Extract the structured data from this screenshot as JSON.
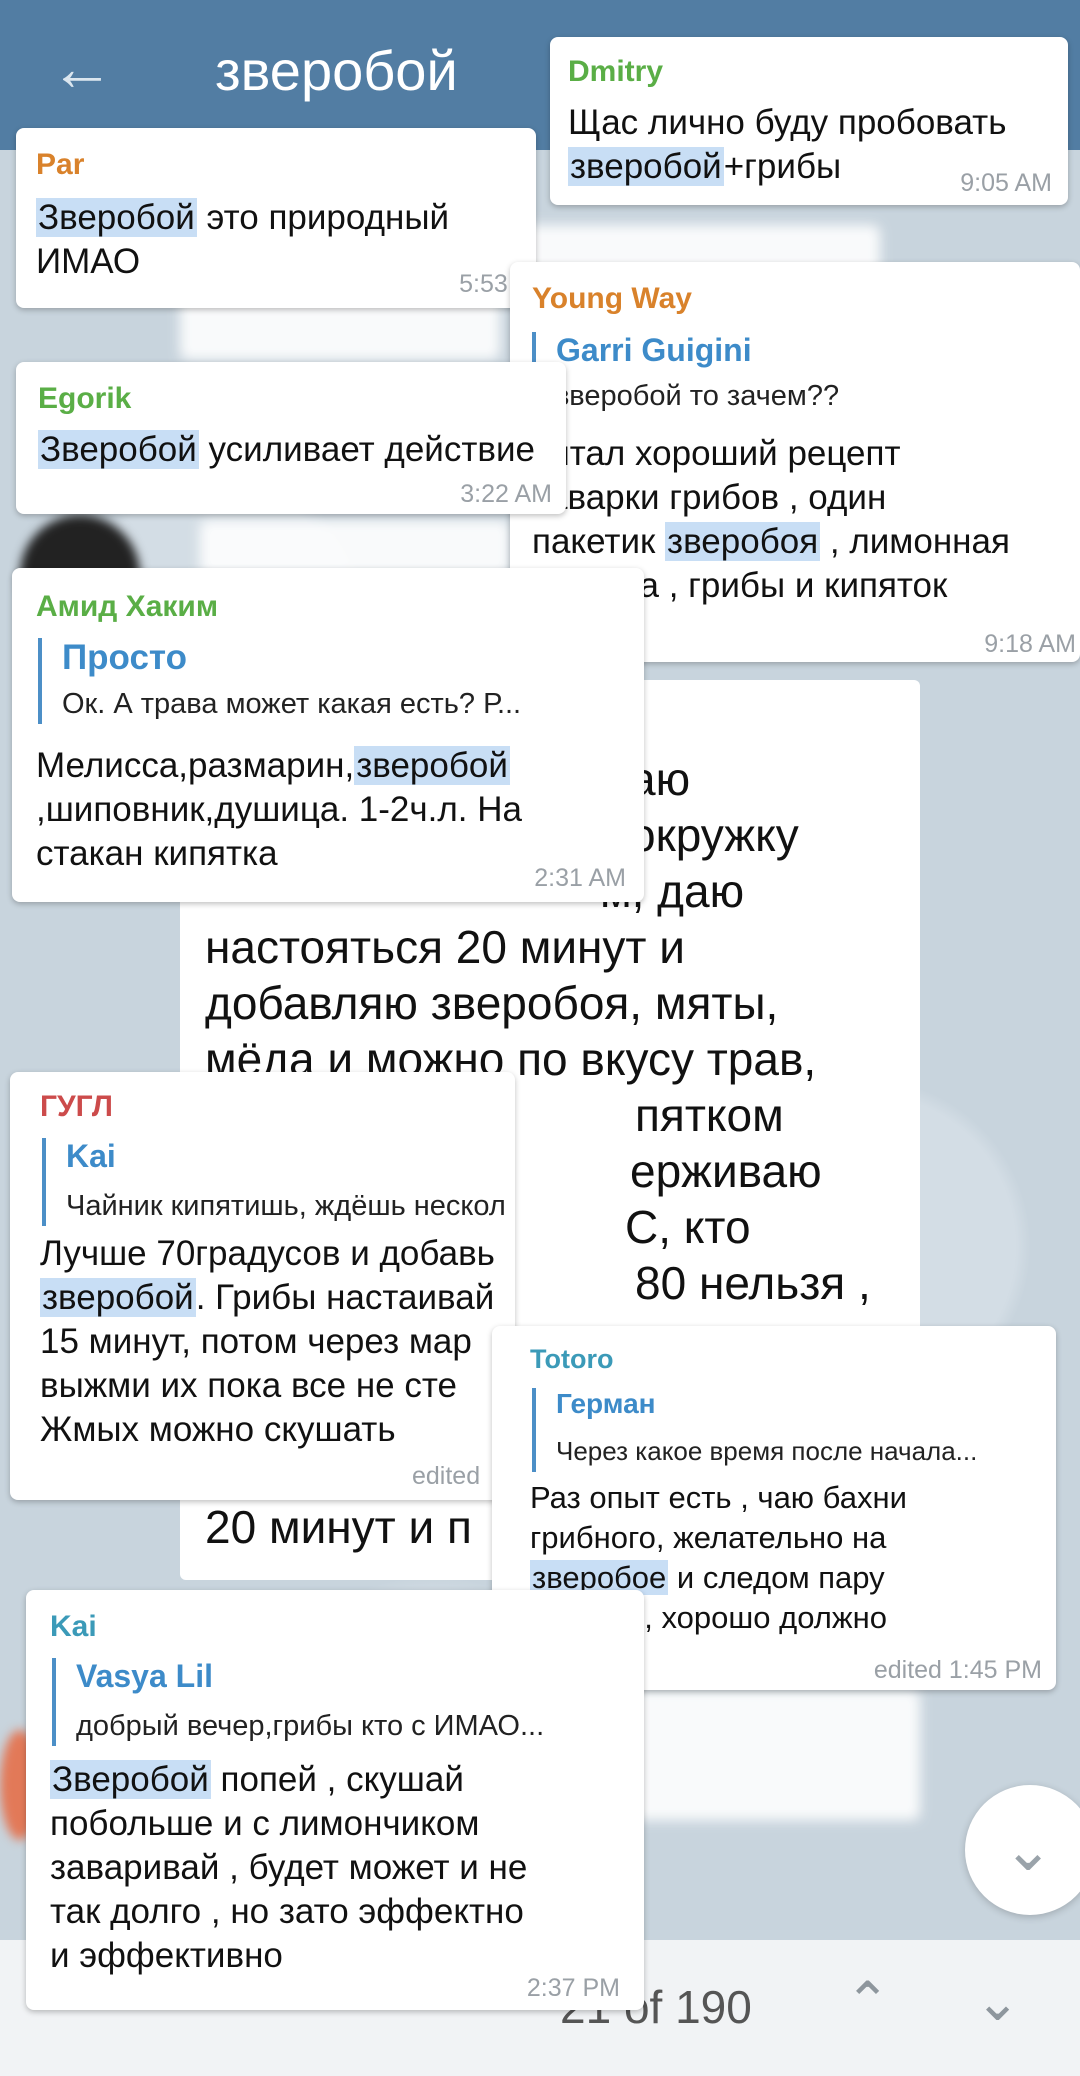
{
  "header": {
    "title": "зверобой"
  },
  "search": {
    "counter": "21 of 190"
  },
  "big_message": {
    "lines": [
      "аю",
      "окружку",
      "м, даю",
      "настояться 20 минут и",
      "добавляю зверобоя, мяты,",
      "мёда и можно по вкусу трав,",
      "пятком",
      "ерживаю",
      "С, кто",
      "80 нельзя ,",
      "20 минут и п"
    ]
  },
  "cards": {
    "dmitry": {
      "name": "Dmitry",
      "pre": "Щас лично буду пробовать\n",
      "hl": "зверобой",
      "post": "+грибы",
      "time": "9:05 AM"
    },
    "par": {
      "name": "Par",
      "pre": "",
      "hl": "Зверобой",
      "post": " это природный\nИМАО",
      "time": "5:53 A"
    },
    "young_way": {
      "name": "Young Way",
      "reply_name": "Garri Guigini",
      "reply_text": "зверобой то зачем??",
      "pre": "читал хороший рецепт\nзаварки грибов , один\nпакетик ",
      "hl": "зверобоя",
      "post": " , лимонная\nкислота , грибы и кипяток",
      "time": "9:18 AM"
    },
    "egorik": {
      "name": "Egorik",
      "pre": "",
      "hl": "Зверобой",
      "post": " усиливает действие",
      "time": "3:22 AM"
    },
    "amid": {
      "name": "Амид Хаким",
      "reply_name": "Просто",
      "reply_text": "Ок. А трава может какая есть? Р...",
      "pre": "Мелисса,размарин,",
      "hl": "зверобой",
      "post": "\n,шиповник,душица. 1-2ч.л. На\nстакан кипятка",
      "time": "2:31 AM"
    },
    "gugl": {
      "name": "ГУГЛ",
      "reply_name": "Kai",
      "reply_text": "Чайник кипятишь, ждёшь нескол...",
      "pre": "Лучше 70градусов и добавь\n",
      "hl": "зверобой",
      "post": ". Грибы настаивай\n15 минут, потом через мар\nвыжми их пока все не сте\nЖмых можно скушать",
      "time": "edited"
    },
    "totoro": {
      "name": "Totoro",
      "reply_name": "Герман",
      "reply_text": "Через какое время после начала...",
      "pre": "Раз опыт есть , чаю бахни\nгрибного, желательно на\n",
      "hl": "зверобое",
      "post": " и следом пару\nводных , хорошо должно\nбыть",
      "time": "edited 1:45 PM"
    },
    "kai": {
      "name": "Kai",
      "reply_name": "Vasya Lil",
      "reply_text": "добрый вечер,грибы кто с ИМАО...",
      "pre": "",
      "hl": "Зверобой",
      "post": " попей , скушай\nпобольше и с лимончиком\nзаваривай , будет может и не\nтак долго , но зато эффектно\nи эффективно",
      "time": "2:37 PM"
    }
  },
  "colors": {
    "header": "#527da3",
    "highlight": "#c8def5",
    "name_orange": "#d9822b",
    "name_green": "#5aae46",
    "name_red": "#cc4b4b",
    "name_teal": "#3b9ab8",
    "name_blue": "#4a8fd0"
  },
  "icons": [
    "back-arrow-icon",
    "scroll-down-icon",
    "chevron-up-icon",
    "chevron-down-icon"
  ]
}
